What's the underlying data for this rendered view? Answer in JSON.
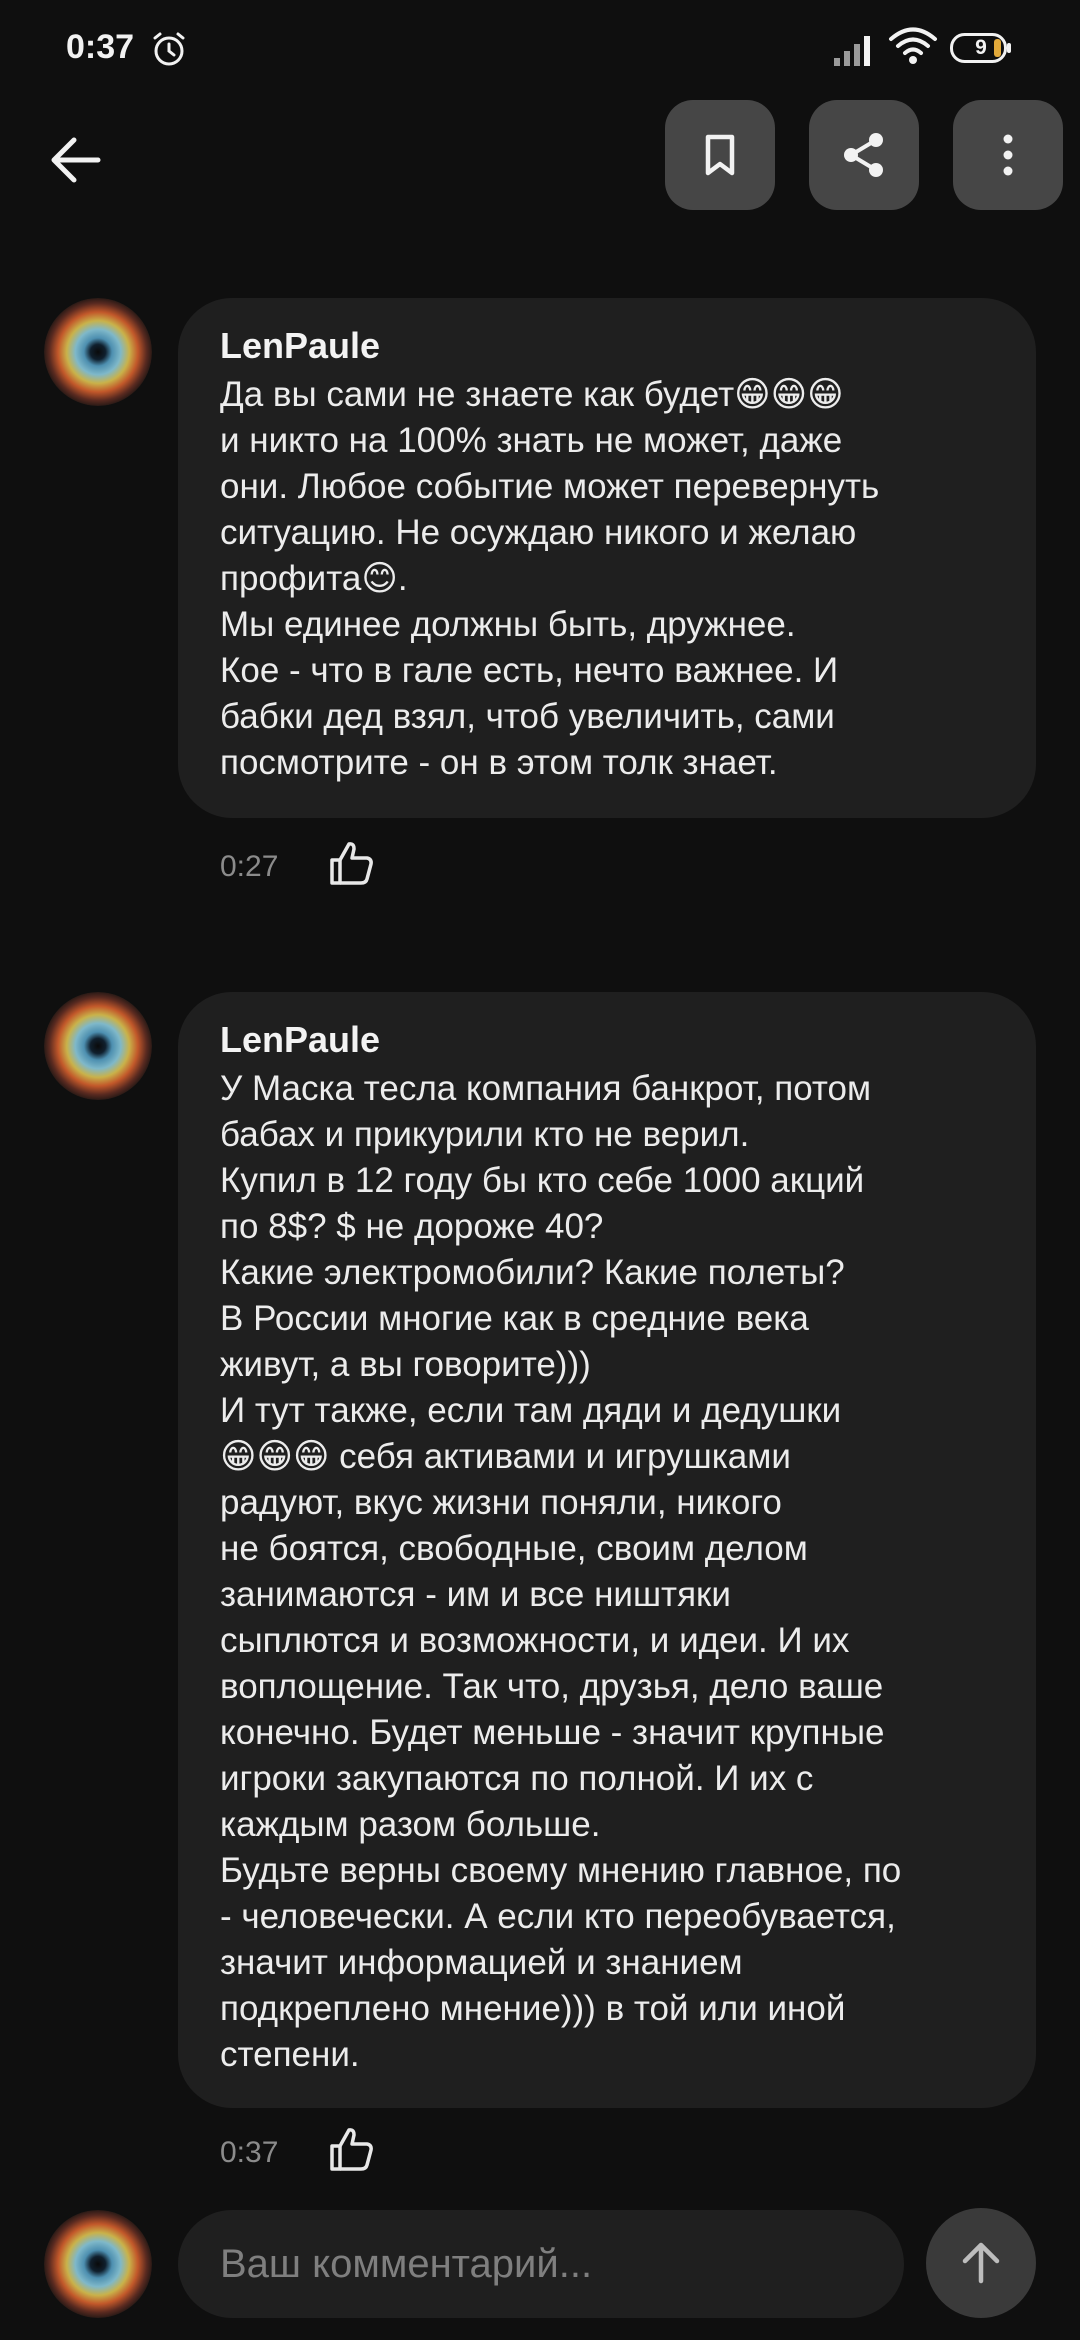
{
  "status_bar": {
    "time": "0:37",
    "battery_level": "9",
    "icons": [
      "alarm-icon",
      "signal-icon",
      "wifi-icon",
      "battery-icon"
    ]
  },
  "toolbar": {
    "icons": [
      "back-arrow-icon",
      "bookmark-icon",
      "share-icon",
      "more-vertical-icon"
    ]
  },
  "comments": [
    {
      "author": "LenPaule",
      "text": "Да вы сами не знаете как будет😁😁😁\nи никто на 100% знать не может, даже\nони. Любое событие может перевернуть\nситуацию. Не осуждаю никого и желаю\nпрофита😊.\nМы единее должны быть, дружнее.\nКое - что в гале есть, нечто важнее. И\nбабки дед взял, чтоб увеличить, сами\nпосмотрите - он в этом толк знает.",
      "time": "0:27"
    },
    {
      "author": "LenPaule",
      "text": "У Маска тесла компания банкрот, потом\nбабах и прикурили кто не верил.\nКупил в 12 году бы кто себе 1000 акций\nпо 8$? $ не дороже 40?\nКакие электромобили? Какие полеты?\nВ России многие как в средние века\nживут, а вы говорите)))\nИ тут также, если там дяди и дедушки\n😁😁😁 себя активами и игрушками\nрадуют, вкус жизни поняли, никого\nне боятся, свободные, своим делом\nзанимаются - им и все ништяки\nсыплются и возможности, и идеи. И их\nвоплощение. Так что, друзья, дело ваше\nконечно. Будет меньше - значит крупные\nигроки закупаются по полной. И их с\nкаждым разом больше.\nБудьте верны своему мнению главное, по\n- человечески. А если кто переобувается,\nзначит информацией и знанием\nподкреплено мнение))) в той или иной\nстепени.",
      "time": "0:37"
    }
  ],
  "composer": {
    "placeholder": "Ваш комментарий..."
  },
  "colors": {
    "background": "#0f0f0f",
    "bubble": "#1f1f1f",
    "toolbar_button": "#464646",
    "send_button": "#3a3a3a",
    "muted_text": "#8b8b8b"
  }
}
